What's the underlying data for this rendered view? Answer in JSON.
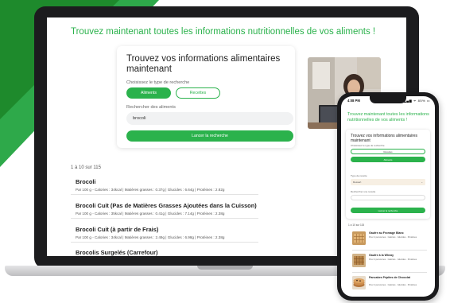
{
  "laptop": {
    "site_title": "Trouvez maintenant toutes les informations nutritionnelles de vos aliments !",
    "search_card": {
      "title": "Trouvez vos informations alimentaires maintenant",
      "search_type_label": "Choisissez le type de recherche",
      "search_type_options": [
        "Aliments",
        "Recettes"
      ],
      "selected_search_type": "Aliments",
      "food_search_label": "Rechercher des aliments",
      "food_search_value": "brocoli",
      "launch_button": "Lancer la recherche"
    },
    "results_count": "1 à 10 sur 115",
    "results": [
      {
        "name": "Brocoli",
        "detail": "Par 100 g - Calories : 34kcal | Matières grasses : 0.37g | Glucides : 6.64g | Protéines : 2.82g"
      },
      {
        "name": "Brocoli Cuit (Pas de Matières Grasses Ajoutées dans la Cuisson)",
        "detail": "Par 100 g - Calories : 35kcal | Matières grasses : 0.41g | Glucides : 7.14g | Protéines : 2.38g"
      },
      {
        "name": "Brocoli Cuit (à partir de Frais)",
        "detail": "Par 100 g - Calories : 34kcal | Matières grasses : 2.49g | Glucides : 6.98g | Protéines : 2.38g"
      },
      {
        "name": "Brocolis Surgelés (Carrefour)",
        "detail": ""
      }
    ]
  },
  "phone": {
    "status_time": "4:08 PM",
    "status_icons": "▂▄▆ ᯤ 85% ▭",
    "site_title": "Trouvez maintenant toutes les informations nutritionnelles de vos aliments !",
    "search_card": {
      "title": "Trouvez vos informations alimentaires maintenant",
      "search_type_label": "Choisissez le type de recherche",
      "option_recipes": "Recettes",
      "option_foods": "Aliments",
      "meal_type_label": "Type de recette",
      "meal_type_value": "Dessert",
      "recipe_search_label": "Rechercher une recette",
      "launch_button": "Lancer la recherche"
    },
    "results_count": "1 à 10 sur 115",
    "results": [
      {
        "name": "Gaufre au Fromage Blanc",
        "sub": "Pour 4 personnes · Calories · Glucides · Protéines"
      },
      {
        "name": "Gaufre à la Wheay",
        "sub": "Pour 4 personnes · Calories · Glucides · Protéines"
      },
      {
        "name": "Pancakes Pépites de Chocolat",
        "sub": "Pour 4 personnes · Calories · Glucides · Protéines"
      }
    ]
  },
  "colors": {
    "accent": "#2bb24c",
    "dark_green": "#1e8a2c",
    "device_frame": "#1c1c1e"
  }
}
